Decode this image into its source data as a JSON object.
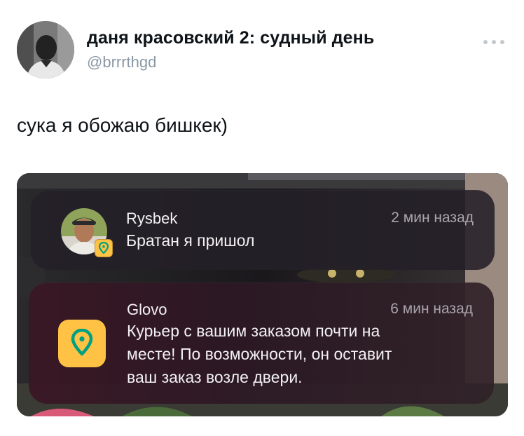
{
  "tweet": {
    "author": {
      "display_name": "даня красовский 2: судный день",
      "handle": "@brrrthgd"
    },
    "text": "сука я обожаю бишкек)"
  },
  "notifications": [
    {
      "app": "Rysbek",
      "time": "2 мин назад",
      "message": "Братан я пришол"
    },
    {
      "app": "Glovo",
      "time": "6 мин назад",
      "message_lines": [
        "Курьер с вашим заказом почти на",
        "месте! По возможности, он оставит",
        "ваш заказ возле двери."
      ]
    }
  ],
  "colors": {
    "glovo_yellow": "#ffc244",
    "glovo_green": "#00a082",
    "handle_gray": "#8b98a5",
    "text_dark": "#0f1419"
  },
  "icons": {
    "more": "more-horizontal-icon",
    "glovo": "glovo-pin-icon"
  }
}
